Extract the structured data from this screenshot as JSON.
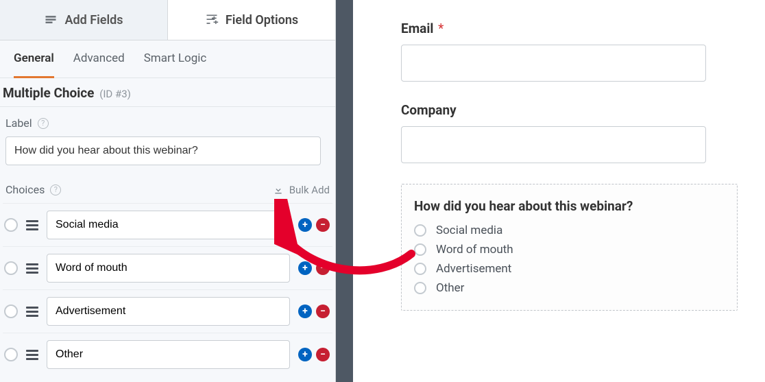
{
  "tabs": {
    "add": "Add Fields",
    "options": "Field Options"
  },
  "subtabs": {
    "general": "General",
    "advanced": "Advanced",
    "smart": "Smart Logic"
  },
  "field": {
    "title": "Multiple Choice",
    "id": "(ID #3)"
  },
  "label_heading": "Label",
  "label_value": "How did you hear about this webinar?",
  "choices_heading": "Choices",
  "bulk_add": "Bulk Add",
  "choices": [
    {
      "value": "Social media"
    },
    {
      "value": "Word of mouth"
    },
    {
      "value": "Advertisement"
    },
    {
      "value": "Other"
    }
  ],
  "preview": {
    "email_label": "Email",
    "company_label": "Company",
    "question": "How did you hear about this webinar?",
    "options": [
      "Social media",
      "Word of mouth",
      "Advertisement",
      "Other"
    ]
  }
}
